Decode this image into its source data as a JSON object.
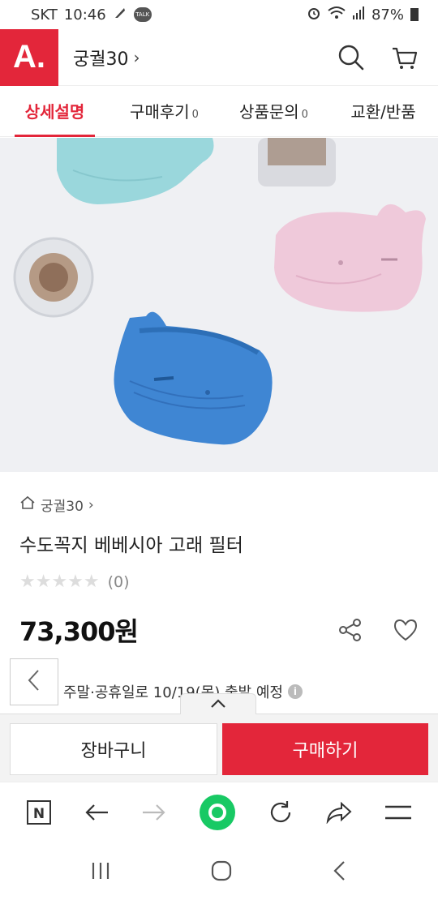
{
  "status_bar": {
    "carrier": "SKT",
    "time": "10:46",
    "talk_badge": "TALK",
    "battery": "87%"
  },
  "header": {
    "logo_text": "A.",
    "store_name": "궁궐30",
    "chevron": "›"
  },
  "tabs": [
    {
      "label": "상세설명",
      "count": ""
    },
    {
      "label": "구매후기",
      "count": "0"
    },
    {
      "label": "상품문의",
      "count": "0"
    },
    {
      "label": "교환/반품",
      "count": ""
    }
  ],
  "product": {
    "breadcrumb_store": "궁궐30",
    "breadcrumb_chevron": "›",
    "title": "수도꼭지 베베시아 고래 필터",
    "stars": "★★★★★",
    "review_count": "(0)",
    "rating": 0,
    "price": "73,300원"
  },
  "delivery": {
    "text": "주말·공휴일로 10/19(목) 출발 예정",
    "info_icon": "i"
  },
  "buy_panel": {
    "cart_label": "장바구니",
    "buy_label": "구매하기"
  },
  "browser_bar": {
    "n_label": "N"
  },
  "colors": {
    "brand_red": "#e3263a",
    "whale_blue": "#3f86d3",
    "whale_pink": "#efc9da",
    "whale_teal": "#9ad7dc",
    "green_dot": "#18c964"
  }
}
